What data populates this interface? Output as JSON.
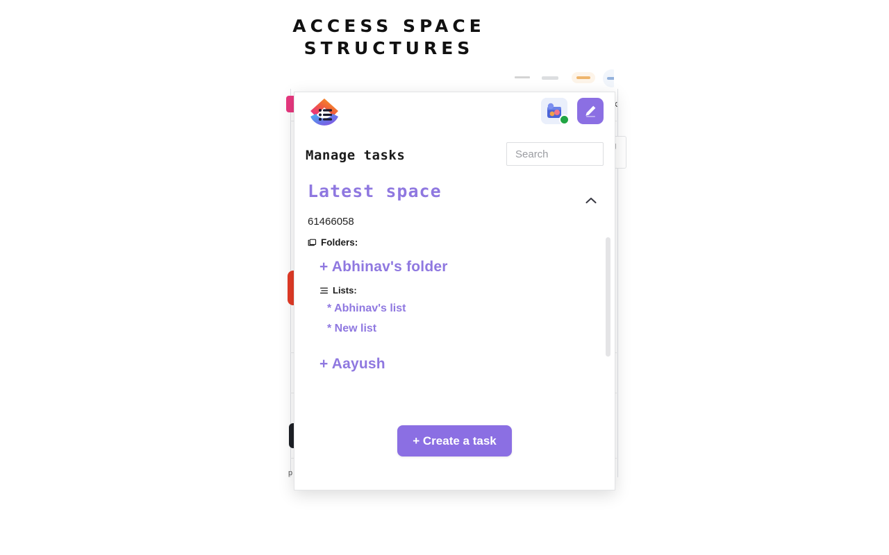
{
  "heading": {
    "text": "ACCESS SPACE\nSTRUCTURES"
  },
  "colors": {
    "accent_purple": "#8b6fe3",
    "space_title_purple": "#8f78e0",
    "online_green": "#21a544",
    "bg_pink": "#e8387f",
    "bg_red": "#e33b27"
  },
  "popup": {
    "logo_name": "clickup-logo",
    "avatar_name": "user-avatar",
    "avatar_status": "online",
    "edit_button_label": "",
    "title": "Manage tasks",
    "search": {
      "value": "",
      "placeholder": "Search"
    },
    "space": {
      "title": "Latest space",
      "id": "61466058",
      "collapsed": false,
      "folders_label": "Folders:",
      "folders": [
        {
          "name": "+ Abhinav's folder",
          "lists_label": "Lists:",
          "lists": [
            {
              "name": "* Abhinav's list"
            },
            {
              "name": "* New list"
            }
          ]
        },
        {
          "name": "+ Aayush",
          "lists_label": "",
          "lists": []
        }
      ]
    },
    "create_task_label": "+ Create a task"
  },
  "background": {
    "fragment_right_top": "ck",
    "fragment_right_mid": "g",
    "fragment_bottom_left": "p"
  }
}
